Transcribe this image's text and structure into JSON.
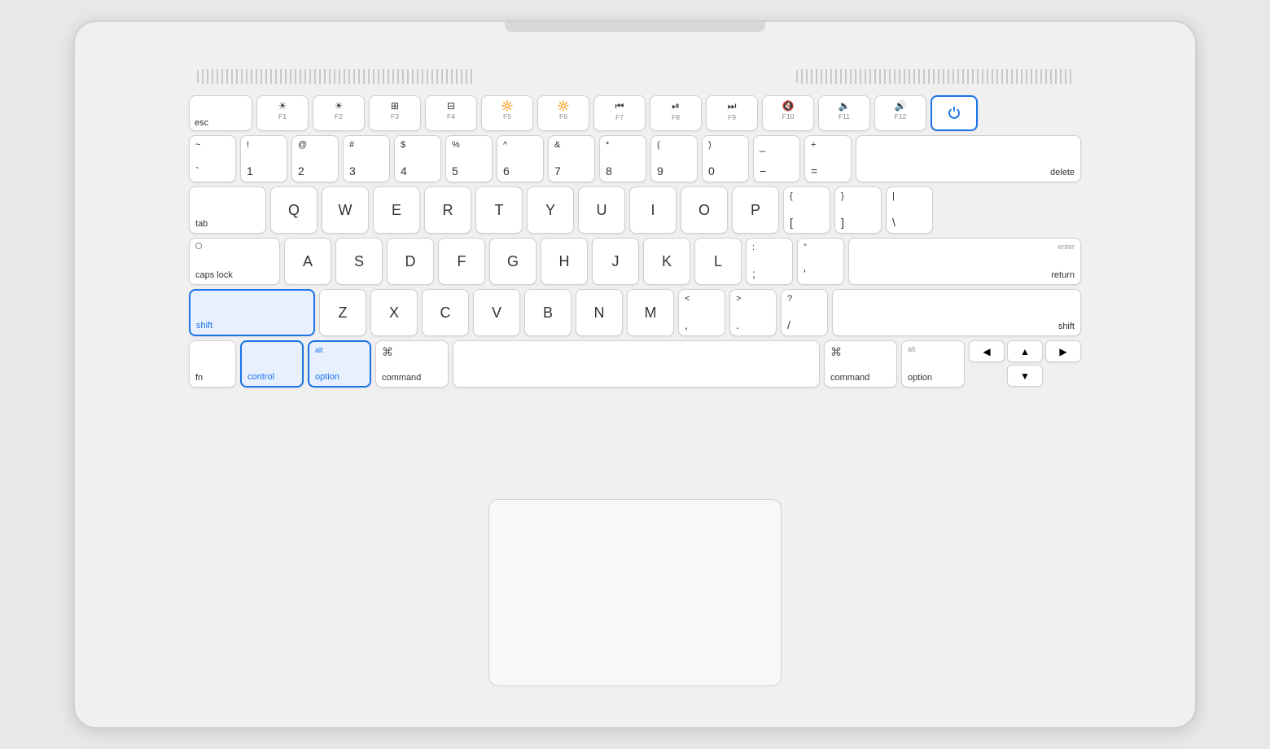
{
  "keyboard": {
    "rows": {
      "fn": {
        "keys": [
          {
            "id": "esc",
            "label": "esc",
            "type": "esc"
          },
          {
            "id": "f1",
            "icon": "☀",
            "label": "F1"
          },
          {
            "id": "f2",
            "icon": "☀",
            "label": "F2"
          },
          {
            "id": "f3",
            "icon": "⊞",
            "label": "F3"
          },
          {
            "id": "f4",
            "icon": "⊟",
            "label": "F4"
          },
          {
            "id": "f5",
            "icon": "☀",
            "label": "F5"
          },
          {
            "id": "f6",
            "icon": "☀",
            "label": "F6"
          },
          {
            "id": "f7",
            "icon": "⏮",
            "label": "F7"
          },
          {
            "id": "f8",
            "icon": "⏯",
            "label": "F8"
          },
          {
            "id": "f9",
            "icon": "⏭",
            "label": "F9"
          },
          {
            "id": "f10",
            "icon": "🔇",
            "label": "F10"
          },
          {
            "id": "f11",
            "icon": "🔉",
            "label": "F11"
          },
          {
            "id": "f12",
            "icon": "🔊",
            "label": "F12"
          },
          {
            "id": "power",
            "label": "power",
            "type": "power"
          }
        ]
      }
    },
    "highlighted_keys": [
      "shift-left",
      "control",
      "option-left"
    ],
    "power_highlighted": true
  },
  "labels": {
    "esc": "esc",
    "tab": "tab",
    "caps_lock": "caps lock",
    "shift": "shift",
    "fn": "fn",
    "control": "control",
    "option": "option",
    "command": "command",
    "alt": "alt",
    "delete": "delete",
    "enter": "enter",
    "return": "return"
  },
  "colors": {
    "highlight_bg": "#e8f0fe",
    "highlight_border": "#1a73e8",
    "highlight_text": "#1a73e8",
    "key_bg": "#ffffff",
    "key_border": "#d0d0d0",
    "body_bg": "#f0f0f0"
  }
}
